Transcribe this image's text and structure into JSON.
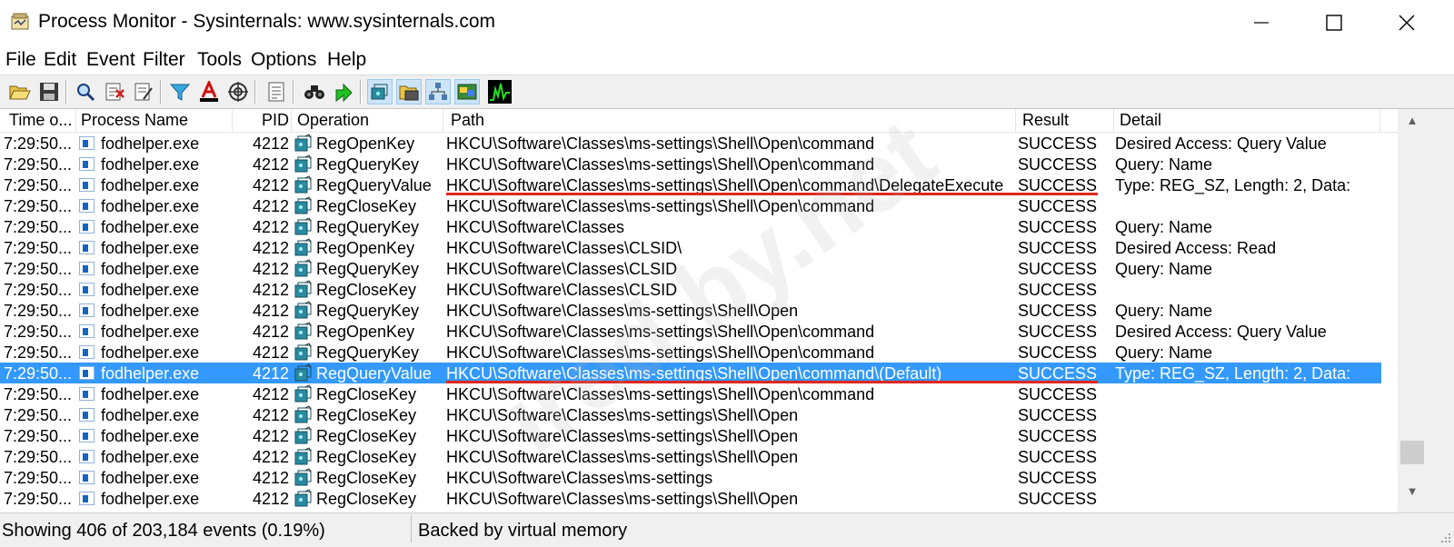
{
  "window": {
    "title": "Process Monitor - Sysinternals: www.sysinternals.com"
  },
  "menu": [
    "File",
    "Edit",
    "Event",
    "Filter",
    "Tools",
    "Options",
    "Help"
  ],
  "toolbar_icons": [
    "open-icon",
    "save-icon",
    "magnify-icon",
    "autoscroll-icon",
    "clear-icon",
    "filter-icon",
    "highlight-icon",
    "include-process-icon",
    "jump-icon",
    "properties-icon",
    "find-icon",
    "jump-to-icon",
    "registry-activity-icon",
    "file-activity-icon",
    "network-activity-icon",
    "process-activity-icon",
    "profiling-events-icon"
  ],
  "columns": {
    "time": "Time o...",
    "process": "Process Name",
    "pid": "PID",
    "operation": "Operation",
    "path": "Path",
    "result": "Result",
    "detail": "Detail"
  },
  "rows": [
    {
      "time": "7:29:50...",
      "process": "fodhelper.exe",
      "pid": "4212",
      "operation": "RegOpenKey",
      "path": "HKCU\\Software\\Classes\\ms-settings\\Shell\\Open\\command",
      "result": "SUCCESS",
      "detail": "Desired Access: Query Value"
    },
    {
      "time": "7:29:50...",
      "process": "fodhelper.exe",
      "pid": "4212",
      "operation": "RegQueryKey",
      "path": "HKCU\\Software\\Classes\\ms-settings\\Shell\\Open\\command",
      "result": "SUCCESS",
      "detail": "Query: Name"
    },
    {
      "time": "7:29:50...",
      "process": "fodhelper.exe",
      "pid": "4212",
      "operation": "RegQueryValue",
      "path": "HKCU\\Software\\Classes\\ms-settings\\Shell\\Open\\command\\DelegateExecute",
      "result": "SUCCESS",
      "detail": "Type: REG_SZ, Length: 2, Data:"
    },
    {
      "time": "7:29:50...",
      "process": "fodhelper.exe",
      "pid": "4212",
      "operation": "RegCloseKey",
      "path": "HKCU\\Software\\Classes\\ms-settings\\Shell\\Open\\command",
      "result": "SUCCESS",
      "detail": ""
    },
    {
      "time": "7:29:50...",
      "process": "fodhelper.exe",
      "pid": "4212",
      "operation": "RegQueryKey",
      "path": "HKCU\\Software\\Classes",
      "result": "SUCCESS",
      "detail": "Query: Name"
    },
    {
      "time": "7:29:50...",
      "process": "fodhelper.exe",
      "pid": "4212",
      "operation": "RegOpenKey",
      "path": "HKCU\\Software\\Classes\\CLSID\\",
      "result": "SUCCESS",
      "detail": "Desired Access: Read"
    },
    {
      "time": "7:29:50...",
      "process": "fodhelper.exe",
      "pid": "4212",
      "operation": "RegQueryKey",
      "path": "HKCU\\Software\\Classes\\CLSID",
      "result": "SUCCESS",
      "detail": "Query: Name"
    },
    {
      "time": "7:29:50...",
      "process": "fodhelper.exe",
      "pid": "4212",
      "operation": "RegCloseKey",
      "path": "HKCU\\Software\\Classes\\CLSID",
      "result": "SUCCESS",
      "detail": ""
    },
    {
      "time": "7:29:50...",
      "process": "fodhelper.exe",
      "pid": "4212",
      "operation": "RegQueryKey",
      "path": "HKCU\\Software\\Classes\\ms-settings\\Shell\\Open",
      "result": "SUCCESS",
      "detail": "Query: Name"
    },
    {
      "time": "7:29:50...",
      "process": "fodhelper.exe",
      "pid": "4212",
      "operation": "RegOpenKey",
      "path": "HKCU\\Software\\Classes\\ms-settings\\Shell\\Open\\command",
      "result": "SUCCESS",
      "detail": "Desired Access: Query Value"
    },
    {
      "time": "7:29:50...",
      "process": "fodhelper.exe",
      "pid": "4212",
      "operation": "RegQueryKey",
      "path": "HKCU\\Software\\Classes\\ms-settings\\Shell\\Open\\command",
      "result": "SUCCESS",
      "detail": "Query: Name"
    },
    {
      "time": "7:29:50...",
      "process": "fodhelper.exe",
      "pid": "4212",
      "operation": "RegQueryValue",
      "path": "HKCU\\Software\\Classes\\ms-settings\\Shell\\Open\\command\\(Default)",
      "result": "SUCCESS",
      "detail": "Type: REG_SZ, Length: 2, Data:"
    },
    {
      "time": "7:29:50...",
      "process": "fodhelper.exe",
      "pid": "4212",
      "operation": "RegCloseKey",
      "path": "HKCU\\Software\\Classes\\ms-settings\\Shell\\Open\\command",
      "result": "SUCCESS",
      "detail": ""
    },
    {
      "time": "7:29:50...",
      "process": "fodhelper.exe",
      "pid": "4212",
      "operation": "RegCloseKey",
      "path": "HKCU\\Software\\Classes\\ms-settings\\Shell\\Open",
      "result": "SUCCESS",
      "detail": ""
    },
    {
      "time": "7:29:50...",
      "process": "fodhelper.exe",
      "pid": "4212",
      "operation": "RegCloseKey",
      "path": "HKCU\\Software\\Classes\\ms-settings\\Shell\\Open",
      "result": "SUCCESS",
      "detail": ""
    },
    {
      "time": "7:29:50...",
      "process": "fodhelper.exe",
      "pid": "4212",
      "operation": "RegCloseKey",
      "path": "HKCU\\Software\\Classes\\ms-settings\\Shell\\Open",
      "result": "SUCCESS",
      "detail": ""
    },
    {
      "time": "7:29:50...",
      "process": "fodhelper.exe",
      "pid": "4212",
      "operation": "RegCloseKey",
      "path": "HKCU\\Software\\Classes\\ms-settings",
      "result": "SUCCESS",
      "detail": ""
    },
    {
      "time": "7:29:50...",
      "process": "fodhelper.exe",
      "pid": "4212",
      "operation": "RegCloseKey",
      "path": "HKCU\\Software\\Classes\\ms-settings\\Shell\\Open",
      "result": "SUCCESS",
      "detail": ""
    }
  ],
  "selected_row": 11,
  "underlined_rows": [
    2,
    11
  ],
  "status": {
    "events": "Showing 406 of 203,184 events (0.19%)",
    "memory": "Backed by virtual memory"
  },
  "watermark": "ired by.net",
  "colors": {
    "selection": "#3399ff",
    "underline": "#e0271b"
  }
}
